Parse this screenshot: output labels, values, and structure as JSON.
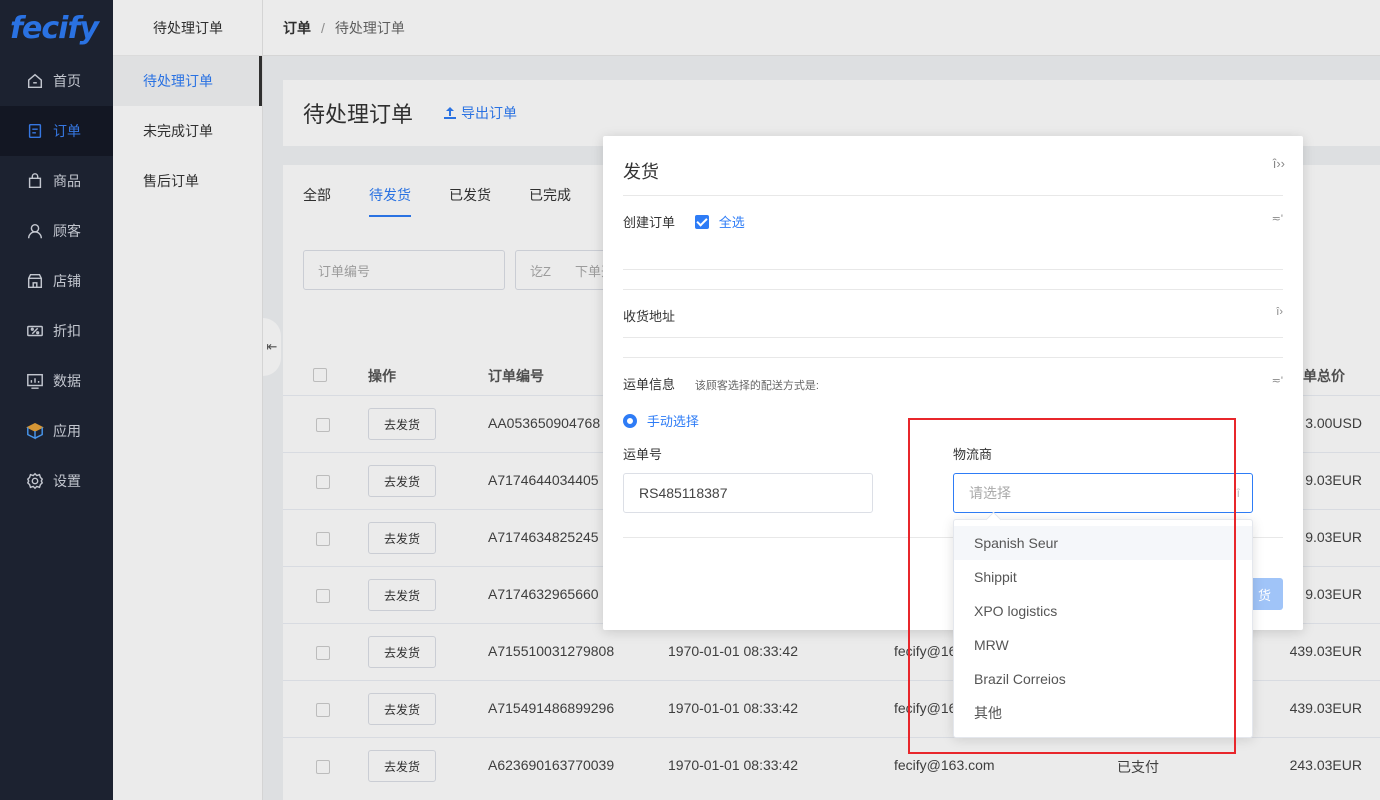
{
  "brand": {
    "logo": "fecify"
  },
  "sidebar": {
    "items": [
      {
        "label": "首页",
        "icon": "home-icon"
      },
      {
        "label": "订单",
        "icon": "order-icon",
        "active": true
      },
      {
        "label": "商品",
        "icon": "bag-icon"
      },
      {
        "label": "顾客",
        "icon": "user-icon"
      },
      {
        "label": "店铺",
        "icon": "shop-icon"
      },
      {
        "label": "折扣",
        "icon": "discount-icon"
      },
      {
        "label": "数据",
        "icon": "chart-icon"
      },
      {
        "label": "应用",
        "icon": "app-icon"
      },
      {
        "label": "设置",
        "icon": "gear-icon"
      }
    ]
  },
  "submenu": {
    "title": "待处理订单",
    "items": [
      "待处理订单",
      "未完成订单",
      "售后订单"
    ]
  },
  "breadcrumb": {
    "root": "订单",
    "sep": "/",
    "current": "待处理订单"
  },
  "page": {
    "title": "待处理订单",
    "export_label": "导出订单"
  },
  "tabs": [
    "全部",
    "待发货",
    "已发货",
    "已完成"
  ],
  "filters": {
    "order_no_placeholder": "订单编号",
    "date_placeholder_a": "讫Z",
    "date_placeholder_b": "下单开"
  },
  "table": {
    "headers": {
      "action": "操作",
      "order_no": "订单编号",
      "total": "单总价"
    },
    "ship_label": "去发货",
    "rows": [
      {
        "order_no": "AA053650904768",
        "time": "",
        "email": "",
        "status": "",
        "total": "3.00USD"
      },
      {
        "order_no": "A7174644034405",
        "time": "",
        "email": "",
        "status": "",
        "total": "9.03EUR"
      },
      {
        "order_no": "A7174634825245",
        "time": "",
        "email": "",
        "status": "",
        "total": "9.03EUR"
      },
      {
        "order_no": "A7174632965660",
        "time": "",
        "email": "",
        "status": "",
        "total": "9.03EUR"
      },
      {
        "order_no": "A715510031279808",
        "time": "1970-01-01 08:33:42",
        "email": "fecify@16",
        "status": "",
        "total": "439.03EUR"
      },
      {
        "order_no": "A715491486899296",
        "time": "1970-01-01 08:33:42",
        "email": "fecify@16",
        "status": "",
        "total": "439.03EUR"
      },
      {
        "order_no": "A623690163770039",
        "time": "1970-01-01 08:33:42",
        "email": "fecify@163.com",
        "status": "已支付",
        "total": "243.03EUR"
      }
    ]
  },
  "modal": {
    "title": "发货",
    "close_glyph": "î››",
    "create_order_label": "创建订单",
    "select_all_label": "全选",
    "address_label": "收货地址",
    "waybill_label": "运单信息",
    "waybill_hint": "该顾客选择的配送方式是:",
    "manual_label": "手动选择",
    "tracking_label": "运单号",
    "tracking_value": "RS485118387",
    "carrier_label": "物流商",
    "carrier_placeholder": "请选择",
    "confirm_label": "货",
    "toggle_glyph_a": "≂'",
    "toggle_glyph_b": "î›",
    "toggle_glyph_c": "≂'",
    "select_glyph": "î"
  },
  "carrier_options": [
    "Spanish Seur",
    "Shippit",
    "XPO logistics",
    "MRW",
    "Brazil Correios",
    "其他"
  ],
  "colors": {
    "accent": "#2e7cf6",
    "sidebar_bg": "#1f2535",
    "highlight_box": "#e8262b"
  }
}
